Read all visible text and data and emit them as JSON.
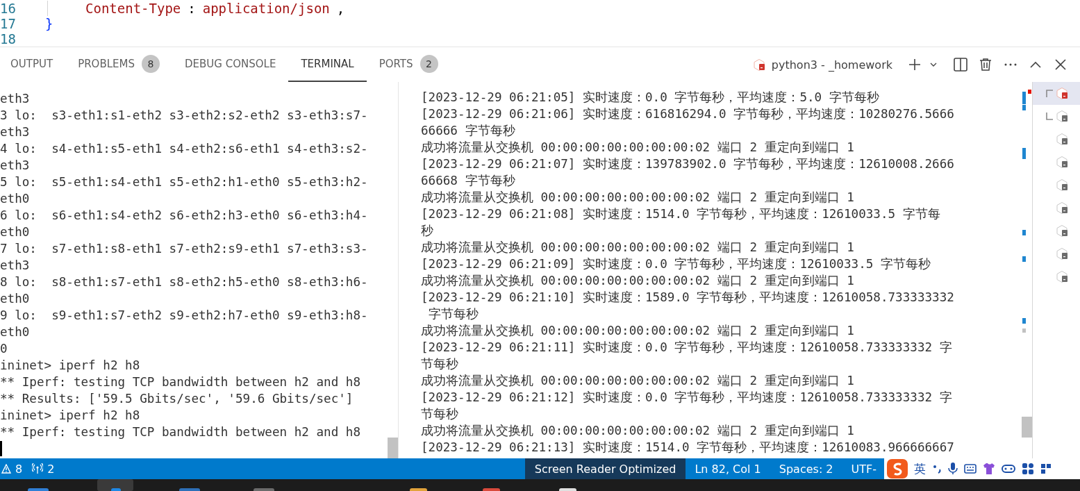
{
  "editor": {
    "lines": [
      {
        "number": "16",
        "tokens": [
          {
            "text": "Content-Type",
            "kind": "string"
          },
          {
            "text": ":",
            "kind": "punct"
          },
          {
            "text": "application/json",
            "kind": "string"
          },
          {
            "text": ",",
            "kind": "punct"
          }
        ]
      },
      {
        "number": "17",
        "tokens": [
          {
            "text": "}",
            "kind": "bracket"
          }
        ]
      },
      {
        "number": "18"
      }
    ]
  },
  "panel": {
    "tabs": [
      {
        "label": "OUTPUT",
        "selected": false
      },
      {
        "label": "PROBLEMS",
        "badge": "8",
        "selected": false
      },
      {
        "label": "DEBUG CONSOLE",
        "selected": false
      },
      {
        "label": "TERMINAL",
        "selected": true
      },
      {
        "label": "PORTS",
        "badge": "2",
        "selected": false
      }
    ],
    "terminal_title": "python3 - _homework"
  },
  "terminal_left": {
    "lines": [
      "eth3",
      "3 lo:  s3-eth1:s1-eth2 s3-eth2:s2-eth2 s3-eth3:s7-",
      "eth3",
      "4 lo:  s4-eth1:s5-eth1 s4-eth2:s6-eth1 s4-eth3:s2-",
      "eth3",
      "5 lo:  s5-eth1:s4-eth1 s5-eth2:h1-eth0 s5-eth3:h2-",
      "eth0",
      "6 lo:  s6-eth1:s4-eth2 s6-eth2:h3-eth0 s6-eth3:h4-",
      "eth0",
      "7 lo:  s7-eth1:s8-eth1 s7-eth2:s9-eth1 s7-eth3:s3-",
      "eth3",
      "8 lo:  s8-eth1:s7-eth1 s8-eth2:h5-eth0 s8-eth3:h6-",
      "eth0",
      "9 lo:  s9-eth1:s7-eth2 s9-eth2:h7-eth0 s9-eth3:h8-",
      "eth0",
      "0",
      "ininet> iperf h2 h8",
      "** Iperf: testing TCP bandwidth between h2 and h8",
      "** Results: ['59.5 Gbits/sec', '59.6 Gbits/sec']",
      "ininet> iperf h2 h8",
      "** Iperf: testing TCP bandwidth between h2 and h8"
    ]
  },
  "terminal_right": {
    "lines": [
      "[2023-12-29 06:21:05] 实时速度：0.0 字节每秒，平均速度：5.0 字节每秒",
      "[2023-12-29 06:21:06] 实时速度：616816294.0 字节每秒，平均速度：10280276.5666",
      "66666 字节每秒",
      "成功将流量从交换机 00:00:00:00:00:00:00:02 端口 2 重定向到端口 1",
      "[2023-12-29 06:21:07] 实时速度：139783902.0 字节每秒，平均速度：12610008.2666",
      "66668 字节每秒",
      "成功将流量从交换机 00:00:00:00:00:00:00:02 端口 2 重定向到端口 1",
      "[2023-12-29 06:21:08] 实时速度：1514.0 字节每秒，平均速度：12610033.5 字节每",
      "秒",
      "成功将流量从交换机 00:00:00:00:00:00:00:02 端口 2 重定向到端口 1",
      "[2023-12-29 06:21:09] 实时速度：0.0 字节每秒，平均速度：12610033.5 字节每秒",
      "成功将流量从交换机 00:00:00:00:00:00:00:02 端口 2 重定向到端口 1",
      "[2023-12-29 06:21:10] 实时速度：1589.0 字节每秒，平均速度：12610058.733333332",
      " 字节每秒",
      "成功将流量从交换机 00:00:00:00:00:00:00:02 端口 2 重定向到端口 1",
      "[2023-12-29 06:21:11] 实时速度：0.0 字节每秒，平均速度：12610058.733333332 字",
      "节每秒",
      "成功将流量从交换机 00:00:00:00:00:00:00:02 端口 2 重定向到端口 1",
      "[2023-12-29 06:21:12] 实时速度：0.0 字节每秒，平均速度：12610058.733333332 字",
      "节每秒",
      "成功将流量从交换机 00:00:00:00:00:00:00:02 端口 2 重定向到端口 1",
      "[2023-12-29 06:21:13] 实时速度：1514.0 字节每秒，平均速度：12610083.966666667"
    ]
  },
  "terminal_list": [
    {
      "kind": "split-top",
      "selected": true
    },
    {
      "kind": "split-bottom",
      "selected": false
    },
    {
      "kind": "single",
      "selected": false
    },
    {
      "kind": "single",
      "selected": false
    },
    {
      "kind": "single",
      "selected": false
    },
    {
      "kind": "single",
      "selected": false
    },
    {
      "kind": "single",
      "selected": false
    },
    {
      "kind": "single",
      "selected": false
    },
    {
      "kind": "single",
      "selected": false
    }
  ],
  "status_bar": {
    "left": [
      {
        "kind": "warnings",
        "text": "8"
      },
      {
        "kind": "ports",
        "text": "2"
      }
    ],
    "right": [
      {
        "text": "Screen Reader Optimized",
        "kind": "highlight"
      },
      {
        "text": "Ln 82, Col 1",
        "kind": "plain"
      },
      {
        "text": "Spaces: 2",
        "kind": "plain"
      },
      {
        "text": "UTF-",
        "kind": "plain"
      }
    ]
  },
  "ime_toolbar": {
    "mode": "英"
  }
}
